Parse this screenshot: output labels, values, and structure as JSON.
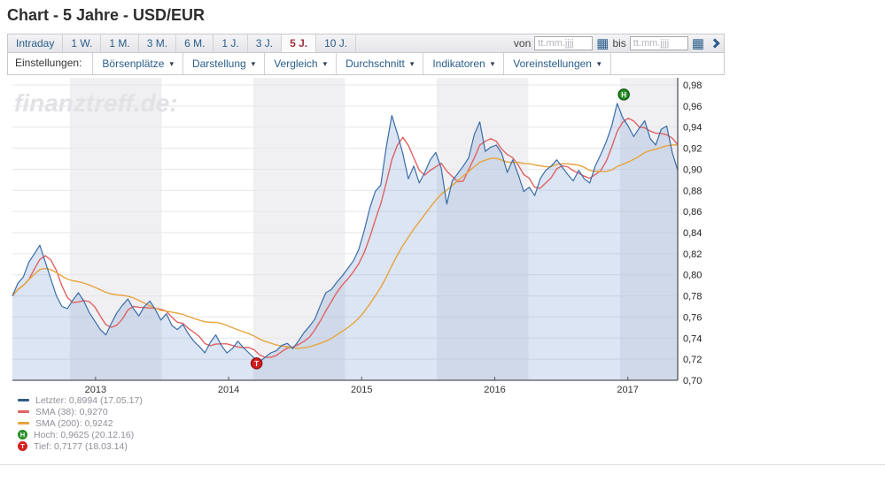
{
  "page": {
    "title": "Chart - 5 Jahre - USD/EUR"
  },
  "toolbar": {
    "range_tabs": [
      {
        "label": "Intraday",
        "active": false
      },
      {
        "label": "1 W.",
        "active": false
      },
      {
        "label": "1 M.",
        "active": false
      },
      {
        "label": "3 M.",
        "active": false
      },
      {
        "label": "6 M.",
        "active": false
      },
      {
        "label": "1 J.",
        "active": false
      },
      {
        "label": "3 J.",
        "active": false
      },
      {
        "label": "5 J.",
        "active": true
      },
      {
        "label": "10 J.",
        "active": false
      }
    ],
    "date_filter": {
      "von_label": "von",
      "bis_label": "bis",
      "von_placeholder": "tt.mm.jjjj",
      "bis_placeholder": "tt.mm.jjjj"
    },
    "settings_label": "Einstellungen:",
    "dropdowns": [
      {
        "label": "Börsenplätze"
      },
      {
        "label": "Darstellung"
      },
      {
        "label": "Vergleich"
      },
      {
        "label": "Durchschnitt"
      },
      {
        "label": "Indikatoren"
      },
      {
        "label": "Voreinstellungen"
      }
    ]
  },
  "watermark": "finanztreff.de:",
  "colors": {
    "price_line": "#3a6ca8",
    "price_fill": "rgba(90,135,200,0.22)",
    "sma38": "#e06262",
    "sma200": "#e8a33d",
    "grid": "#e6e6e9",
    "stripe": "#f0f0f3",
    "axis": "#53565a",
    "high_marker": "#2a8f2a",
    "low_marker": "#d42020",
    "active_tab_text": "#a03340",
    "link_blue": "#2a5d8a"
  },
  "chart_data": {
    "type": "line",
    "title": "USD/EUR 5 Jahre",
    "x_axis": {
      "start_year": 2012.375,
      "end_year": 2017.375
    },
    "ylim": [
      0.7,
      0.98
    ],
    "grid": true,
    "legend_position": "bottom-left",
    "y_ticks": [
      {
        "label": "0,98",
        "value": 0.98
      },
      {
        "label": "0,96",
        "value": 0.96
      },
      {
        "label": "0,94",
        "value": 0.94
      },
      {
        "label": "0,92",
        "value": 0.92
      },
      {
        "label": "0,90",
        "value": 0.9
      },
      {
        "label": "0,88",
        "value": 0.88
      },
      {
        "label": "0,86",
        "value": 0.86
      },
      {
        "label": "0,84",
        "value": 0.84
      },
      {
        "label": "0,82",
        "value": 0.82
      },
      {
        "label": "0,80",
        "value": 0.8
      },
      {
        "label": "0,78",
        "value": 0.78
      },
      {
        "label": "0,76",
        "value": 0.76
      },
      {
        "label": "0,74",
        "value": 0.74
      },
      {
        "label": "0,72",
        "value": 0.72
      },
      {
        "label": "0,70",
        "value": 0.7
      }
    ],
    "x_ticks": [
      {
        "label": "2013",
        "year": 2013
      },
      {
        "label": "2014",
        "year": 2014
      },
      {
        "label": "2015",
        "year": 2015
      },
      {
        "label": "2016",
        "year": 2016
      },
      {
        "label": "2017",
        "year": 2017
      }
    ],
    "series": [
      {
        "name": "Letzter",
        "color": "#3a6ca8",
        "last_value": 0.8994,
        "last_date": "17.05.17",
        "values": [
          0.78,
          0.792,
          0.798,
          0.812,
          0.82,
          0.828,
          0.812,
          0.796,
          0.78,
          0.77,
          0.768,
          0.776,
          0.783,
          0.775,
          0.764,
          0.756,
          0.748,
          0.743,
          0.754,
          0.764,
          0.771,
          0.777,
          0.768,
          0.761,
          0.77,
          0.775,
          0.767,
          0.757,
          0.763,
          0.752,
          0.748,
          0.753,
          0.744,
          0.737,
          0.732,
          0.726,
          0.736,
          0.743,
          0.733,
          0.726,
          0.73,
          0.737,
          0.731,
          0.726,
          0.721,
          0.7177,
          0.722,
          0.726,
          0.728,
          0.733,
          0.735,
          0.73,
          0.737,
          0.745,
          0.751,
          0.758,
          0.771,
          0.783,
          0.786,
          0.793,
          0.799,
          0.806,
          0.813,
          0.824,
          0.842,
          0.863,
          0.879,
          0.885,
          0.921,
          0.951,
          0.934,
          0.915,
          0.891,
          0.903,
          0.887,
          0.897,
          0.909,
          0.916,
          0.901,
          0.867,
          0.889,
          0.896,
          0.903,
          0.911,
          0.933,
          0.945,
          0.917,
          0.921,
          0.923,
          0.915,
          0.897,
          0.909,
          0.895,
          0.879,
          0.883,
          0.875,
          0.891,
          0.899,
          0.903,
          0.909,
          0.902,
          0.895,
          0.889,
          0.899,
          0.891,
          0.887,
          0.903,
          0.914,
          0.926,
          0.941,
          0.9625,
          0.949,
          0.941,
          0.931,
          0.939,
          0.946,
          0.929,
          0.923,
          0.938,
          0.941,
          0.916,
          0.899
        ]
      },
      {
        "name": "SMA (38)",
        "color": "#e06262",
        "derived": "sma",
        "window": 4,
        "display_value": 0.927
      },
      {
        "name": "SMA (200)",
        "color": "#e8a33d",
        "derived": "sma",
        "window": 20,
        "display_value": 0.9242
      }
    ],
    "markers": [
      {
        "id": "H",
        "name": "Hoch",
        "value": 0.9625,
        "date": "20.12.16",
        "year": 2016.97,
        "color": "#2a8f2a",
        "stroke": "#0f5f0f"
      },
      {
        "id": "T",
        "name": "Tief",
        "value": 0.7177,
        "date": "18.03.14",
        "year": 2014.21,
        "color": "#d42020",
        "stroke": "#991111"
      }
    ],
    "legend": [
      {
        "swatch": "line",
        "color": "#335c85",
        "text": "Letzter: 0,8994 (17.05.17)"
      },
      {
        "swatch": "line",
        "color": "#e06262",
        "text": "SMA (38): 0,9270"
      },
      {
        "swatch": "line",
        "color": "#e8a33d",
        "text": "SMA (200): 0,9242"
      },
      {
        "swatch": "badge",
        "letter": "H",
        "color": "#2a8f2a",
        "text": "Hoch: 0,9625 (20.12.16)"
      },
      {
        "swatch": "badge",
        "letter": "T",
        "color": "#d42020",
        "text": "Tief: 0,7177 (18.03.14)"
      }
    ]
  }
}
